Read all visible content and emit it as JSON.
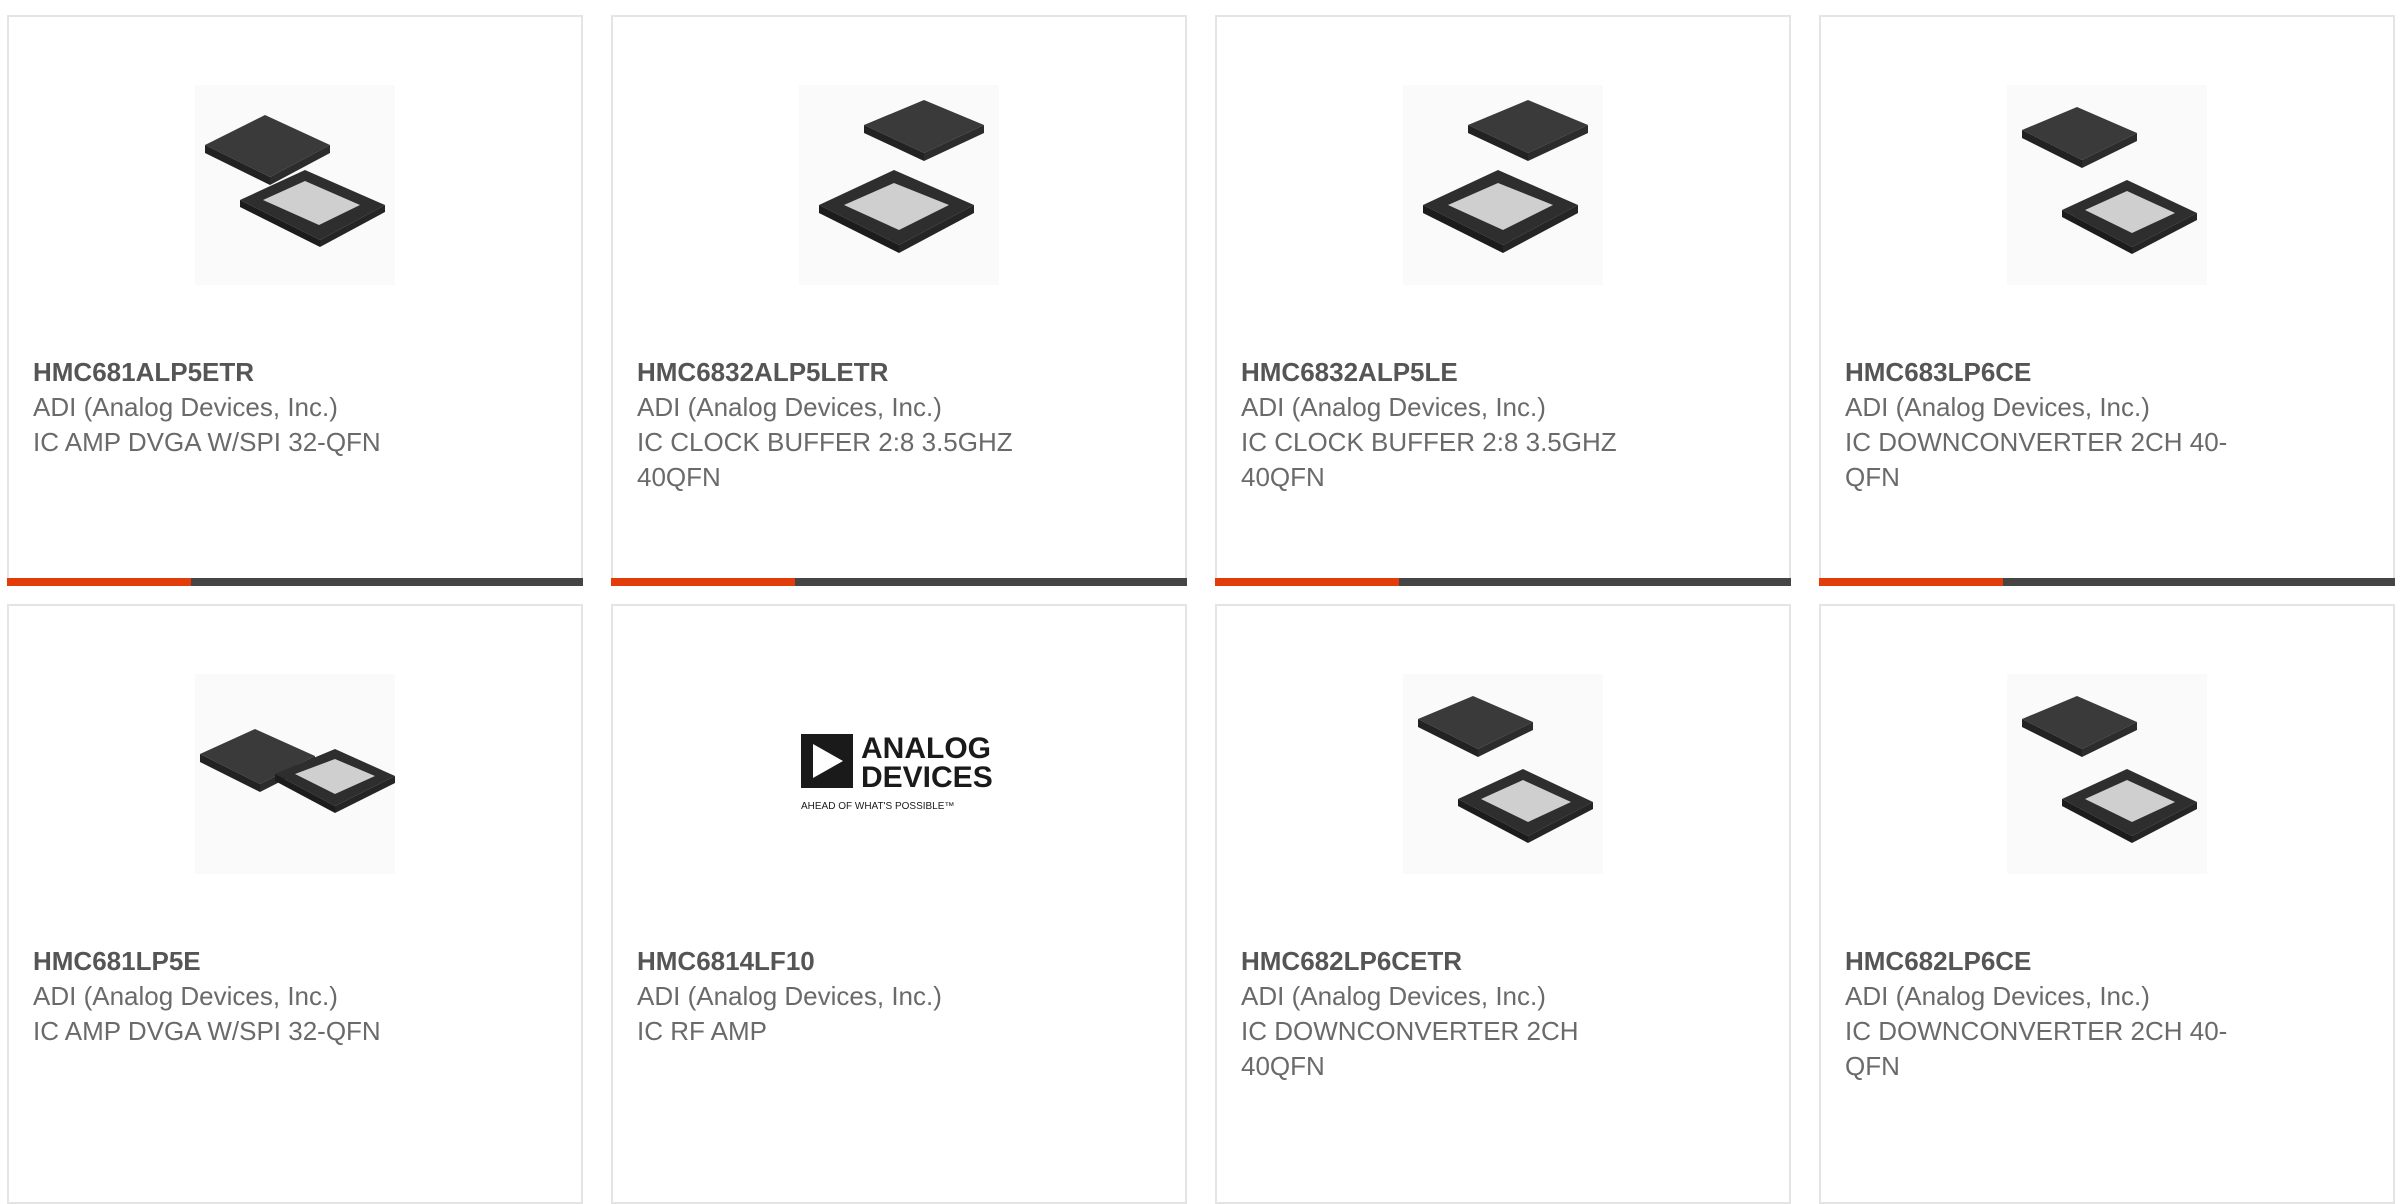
{
  "colors": {
    "accent": "#e23c0a",
    "bar": "#454545",
    "border": "#e4e4e4",
    "text": "#6a6a6a"
  },
  "products": [
    {
      "part_number": "HMC681ALP5ETR",
      "manufacturer": "ADI (Analog Devices, Inc.)",
      "description": "IC AMP DVGA W/SPI 32-QFN",
      "image": "qfn-chip-pair-image",
      "progress_fraction": 0.32
    },
    {
      "part_number": "HMC6832ALP5LETR",
      "manufacturer": "ADI (Analog Devices, Inc.)",
      "description": "IC CLOCK BUFFER 2:8 3.5GHZ 40QFN",
      "image": "qfn-chip-pair-image",
      "progress_fraction": 0.32
    },
    {
      "part_number": "HMC6832ALP5LE",
      "manufacturer": "ADI (Analog Devices, Inc.)",
      "description": "IC CLOCK BUFFER 2:8 3.5GHZ 40QFN",
      "image": "qfn-chip-pair-image",
      "progress_fraction": 0.32
    },
    {
      "part_number": "HMC683LP6CE",
      "manufacturer": "ADI (Analog Devices, Inc.)",
      "description": "IC DOWNCONVERTER 2CH 40-QFN",
      "image": "qfn-chip-pair-image",
      "progress_fraction": 0.32
    },
    {
      "part_number": "HMC681LP5E",
      "manufacturer": "ADI (Analog Devices, Inc.)",
      "description": "IC AMP DVGA W/SPI 32-QFN",
      "image": "qfn-chip-pair-image"
    },
    {
      "part_number": "HMC6814LF10",
      "manufacturer": "ADI (Analog Devices, Inc.)",
      "description": "IC RF AMP",
      "image": "analog-devices-logo",
      "logo_text": {
        "line1": "ANALOG",
        "line2": "DEVICES",
        "tagline": "AHEAD OF WHAT'S POSSIBLE™"
      }
    },
    {
      "part_number": "HMC682LP6CETR",
      "manufacturer": "ADI (Analog Devices, Inc.)",
      "description": "IC DOWNCONVERTER 2CH 40QFN",
      "image": "qfn-chip-pair-image"
    },
    {
      "part_number": "HMC682LP6CE",
      "manufacturer": "ADI (Analog Devices, Inc.)",
      "description": "IC DOWNCONVERTER 2CH 40-QFN",
      "image": "qfn-chip-pair-image"
    }
  ]
}
